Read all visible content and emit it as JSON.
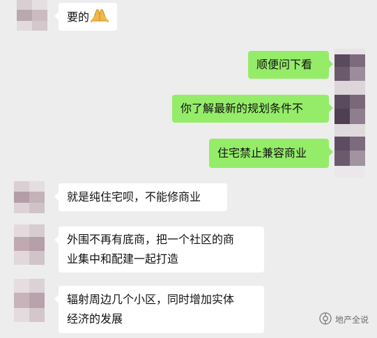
{
  "messages": [
    {
      "side": "left",
      "lines": [
        "要的"
      ],
      "emoji": "folded-hands"
    },
    {
      "side": "right",
      "lines": [
        "顺便问下看"
      ]
    },
    {
      "side": "right",
      "lines": [
        "你了解最新的规划条件不"
      ]
    },
    {
      "side": "right",
      "lines": [
        "住宅禁止兼容商业"
      ]
    },
    {
      "side": "left",
      "lines": [
        "就是纯住宅呗，不能修商业"
      ]
    },
    {
      "side": "left",
      "lines": [
        "外围不再有底商，把一个社区的商",
        "业集中和配建一起打造"
      ]
    },
    {
      "side": "left",
      "lines": [
        "辐射周边几个小区，同时增加实体",
        "经济的发展"
      ]
    }
  ],
  "watermark": {
    "text": "地产全说",
    "icon": "wechat-official-account-icon"
  },
  "colors": {
    "background": "#ededed",
    "bubble_right": "#95ec69",
    "bubble_left": "#ffffff",
    "text": "#111111"
  }
}
